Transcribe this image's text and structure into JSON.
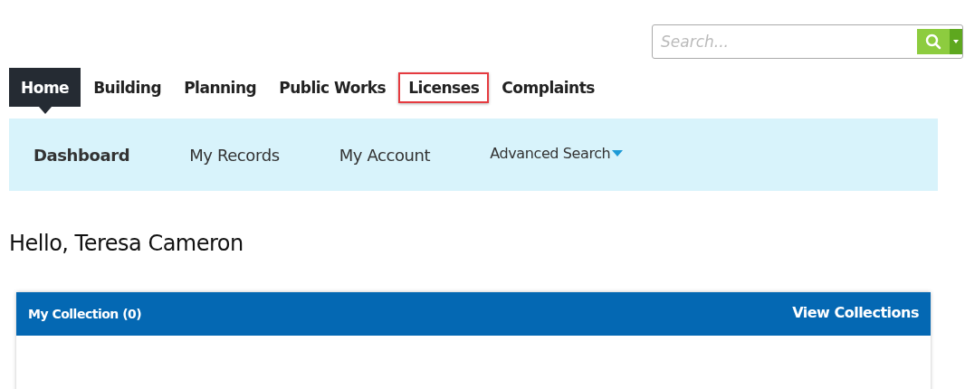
{
  "search": {
    "placeholder": "Search..."
  },
  "tabs": [
    {
      "label": "Home",
      "selected": true,
      "highlighted": false
    },
    {
      "label": "Building",
      "selected": false,
      "highlighted": false
    },
    {
      "label": "Planning",
      "selected": false,
      "highlighted": false
    },
    {
      "label": "Public Works",
      "selected": false,
      "highlighted": false
    },
    {
      "label": "Licenses",
      "selected": false,
      "highlighted": true
    },
    {
      "label": "Complaints",
      "selected": false,
      "highlighted": false
    }
  ],
  "subnav": [
    {
      "label": "Dashboard",
      "selected": true,
      "dropdown": false
    },
    {
      "label": "My Records",
      "selected": false,
      "dropdown": false
    },
    {
      "label": "My Account",
      "selected": false,
      "dropdown": false
    },
    {
      "label": "Advanced Search",
      "selected": false,
      "dropdown": true
    }
  ],
  "greeting": "Hello, Teresa Cameron",
  "collection": {
    "title": "My Collection (0)",
    "link": "View Collections"
  }
}
